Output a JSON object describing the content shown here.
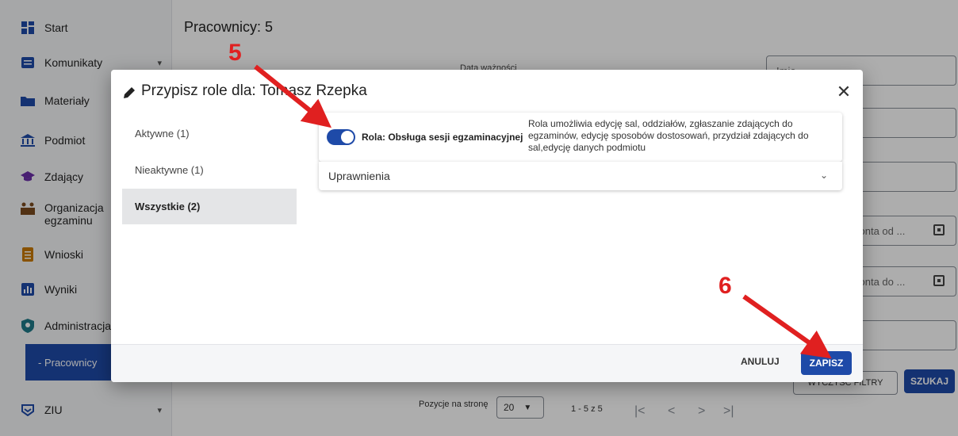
{
  "sidebar": {
    "items": [
      {
        "label": "Start",
        "icon": "dashboard-icon"
      },
      {
        "label": "Komunikaty",
        "icon": "message-icon"
      },
      {
        "label": "Materiały",
        "icon": "folder-icon"
      },
      {
        "label": "Podmiot",
        "icon": "institution-icon"
      },
      {
        "label": "Zdający",
        "icon": "graduation-cap-icon"
      },
      {
        "label": "Organizacja egzaminu",
        "icon": "organization-icon"
      },
      {
        "label": "Wnioski",
        "icon": "document-icon"
      },
      {
        "label": "Wyniki",
        "icon": "chart-icon"
      },
      {
        "label": "Administracja",
        "icon": "shield-icon"
      },
      {
        "label": "ZIU",
        "icon": "ziu-icon"
      }
    ],
    "sub_item": "- Pracownicy"
  },
  "main": {
    "title": "Pracownicy: 5",
    "headers": [
      "Data ważności"
    ],
    "fields": [
      "Imię",
      "konta od ...",
      "konta do ..."
    ],
    "filter_button": "WYCZYŚĆ FILTRY",
    "search_button": "SZUKAJ",
    "pager": {
      "per_page_label": "Pozycje na stronę",
      "per_page_value": "20",
      "range": "1 - 5 z 5"
    }
  },
  "modal": {
    "title": "Przypisz role dla: Tomasz Rzepka",
    "tabs": [
      "Aktywne (1)",
      "Nieaktywne (1)",
      "Wszystkie (2)"
    ],
    "role": {
      "name": "Rola: Obsługa sesji egzaminacyjnej",
      "description": "Rola umożliwia edycję sal, oddziałów, zgłaszanie zdających do egzaminów, edycję sposobów dostosowań, przydział zdających do sal,edycję danych podmiotu",
      "enabled": true
    },
    "permissions_label": "Uprawnienia",
    "cancel_label": "ANULUJ",
    "save_label": "ZAPISZ"
  },
  "annotations": [
    "5",
    "6"
  ],
  "colors": {
    "accent": "#1e4aa8",
    "annotation": "#e02020"
  }
}
